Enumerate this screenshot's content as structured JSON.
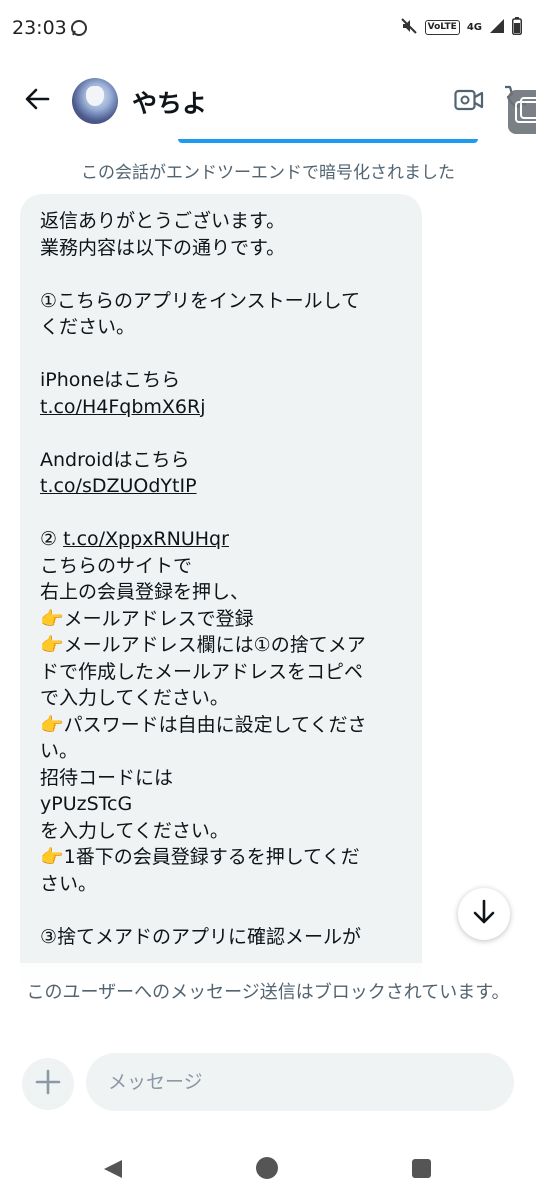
{
  "status_bar": {
    "time": "23:03",
    "network": "4G",
    "volte": "VoLTE"
  },
  "header": {
    "name": "やちよ"
  },
  "conversation": {
    "encryption_notice": "この会話がエンドツーエンドで暗号化されました",
    "message_lines": [
      "返信ありがとうございます。",
      "業務内容は以下の通りです。",
      "",
      "①こちらのアプリをインストールして",
      "ください。",
      "",
      "iPhoneはこちら",
      "t.co/H4FqbmX6Rj",
      "",
      "Androidはこちら",
      "t.co/sDZUOdYtIP",
      "",
      "② t.co/XppxRNUHqr",
      "こちらのサイトで",
      "右上の会員登録を押し、",
      "👉メールアドレスで登録",
      "👉メールアドレス欄には①の捨てメア",
      "ドで作成したメールアドレスをコピペ",
      "で入力してください。",
      "👉パスワードは自由に設定してくださ",
      "い。",
      "招待コードには",
      "yPUzSTcG",
      "を入力してください。",
      "👉1番下の会員登録するを押してくだ",
      "さい。",
      "",
      "③捨てメアドのアプリに確認メールが"
    ],
    "blocked_notice": "このユーザーへのメッセージ送信はブロックされています。"
  },
  "composer": {
    "placeholder": "メッセージ"
  },
  "colors": {
    "accent": "#1d9bf0",
    "bubble_bg": "#eff3f4",
    "muted_text": "#536471"
  }
}
